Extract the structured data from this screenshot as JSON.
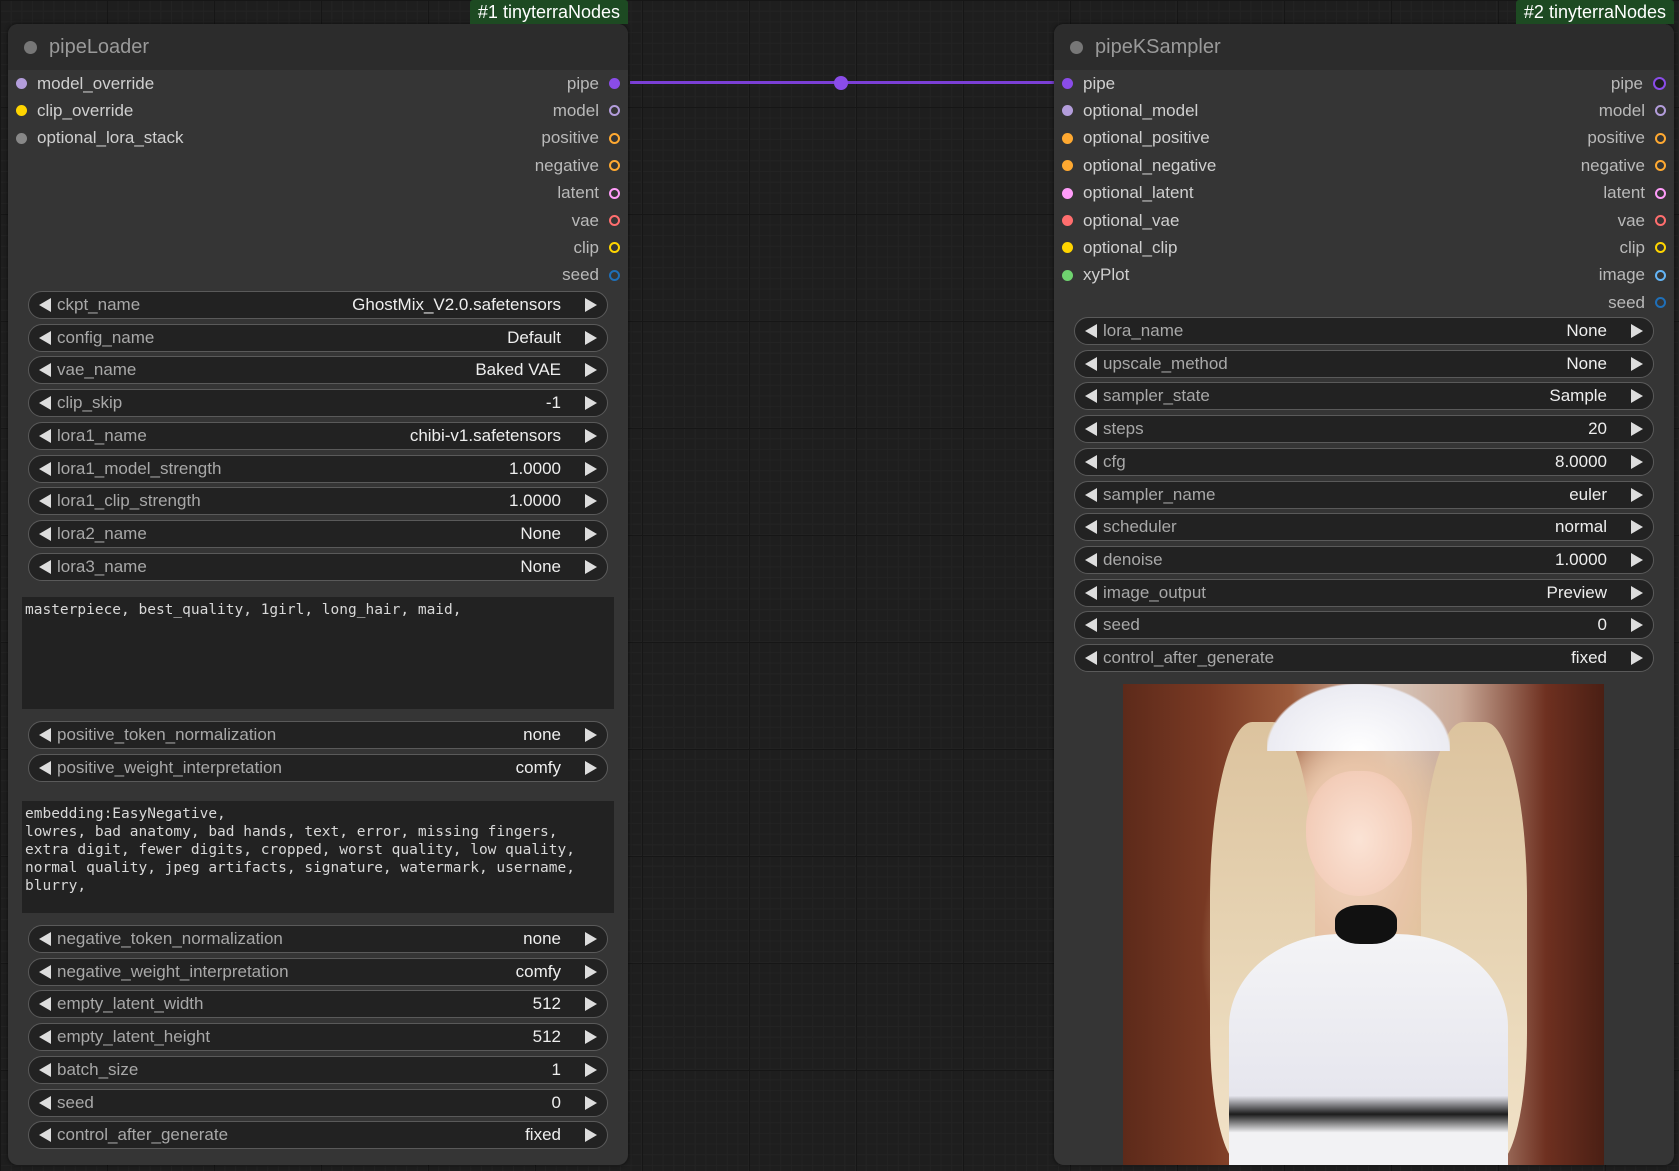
{
  "links": {
    "color": "#7b3fd6"
  },
  "nodes": [
    {
      "badge": "#1 tinyterraNodes",
      "title": "pipeLoader",
      "inputs": [
        {
          "label": "model_override",
          "color": "#b39ddb"
        },
        {
          "label": "clip_override",
          "color": "#ffd500"
        },
        {
          "label": "optional_lora_stack",
          "color": "#888888"
        }
      ],
      "outputs": [
        {
          "label": "pipe",
          "color": "#8a4ce8"
        },
        {
          "label": "model",
          "color": "#b39ddb"
        },
        {
          "label": "positive",
          "color": "#ffa931"
        },
        {
          "label": "negative",
          "color": "#ffa931"
        },
        {
          "label": "latent",
          "color": "#ff9cf9"
        },
        {
          "label": "vae",
          "color": "#ff6e6e"
        },
        {
          "label": "clip",
          "color": "#ffd500"
        },
        {
          "label": "seed",
          "color": "#1f6fb8"
        }
      ],
      "widgets_a": [
        {
          "label": "ckpt_name",
          "value": "GhostMix_V2.0.safetensors"
        },
        {
          "label": "config_name",
          "value": "Default"
        },
        {
          "label": "vae_name",
          "value": "Baked VAE"
        },
        {
          "label": "clip_skip",
          "value": "-1"
        },
        {
          "label": "lora1_name",
          "value": "chibi-v1.safetensors"
        },
        {
          "label": "lora1_model_strength",
          "value": "1.0000"
        },
        {
          "label": "lora1_clip_strength",
          "value": "1.0000"
        },
        {
          "label": "lora2_name",
          "value": "None"
        },
        {
          "label": "lora3_name",
          "value": "None"
        }
      ],
      "positive_text": "masterpiece, best_quality, 1girl, long_hair, maid,",
      "widgets_b": [
        {
          "label": "positive_token_normalization",
          "value": "none"
        },
        {
          "label": "positive_weight_interpretation",
          "value": "comfy"
        }
      ],
      "negative_text": "embedding:EasyNegative,\nlowres, bad anatomy, bad hands, text, error, missing fingers,\nextra digit, fewer digits, cropped, worst quality, low quality,\nnormal quality, jpeg artifacts, signature, watermark, username,\nblurry,",
      "widgets_c": [
        {
          "label": "negative_token_normalization",
          "value": "none"
        },
        {
          "label": "negative_weight_interpretation",
          "value": "comfy"
        },
        {
          "label": "empty_latent_width",
          "value": "512"
        },
        {
          "label": "empty_latent_height",
          "value": "512"
        },
        {
          "label": "batch_size",
          "value": "1"
        },
        {
          "label": "seed",
          "value": "0"
        },
        {
          "label": "control_after_generate",
          "value": "fixed"
        }
      ]
    },
    {
      "badge": "#2 tinyterraNodes",
      "title": "pipeKSampler",
      "inputs": [
        {
          "label": "pipe",
          "color": "#8a4ce8"
        },
        {
          "label": "optional_model",
          "color": "#b39ddb"
        },
        {
          "label": "optional_positive",
          "color": "#ffa931"
        },
        {
          "label": "optional_negative",
          "color": "#ffa931"
        },
        {
          "label": "optional_latent",
          "color": "#ff9cf9"
        },
        {
          "label": "optional_vae",
          "color": "#ff6e6e"
        },
        {
          "label": "optional_clip",
          "color": "#ffd500"
        },
        {
          "label": "xyPlot",
          "color": "#6fd36f"
        }
      ],
      "outputs": [
        {
          "label": "pipe",
          "color": "#8a4ce8"
        },
        {
          "label": "model",
          "color": "#b39ddb"
        },
        {
          "label": "positive",
          "color": "#ffa931"
        },
        {
          "label": "negative",
          "color": "#ffa931"
        },
        {
          "label": "latent",
          "color": "#ff9cf9"
        },
        {
          "label": "vae",
          "color": "#ff6e6e"
        },
        {
          "label": "clip",
          "color": "#ffd500"
        },
        {
          "label": "image",
          "color": "#64b5f6"
        },
        {
          "label": "seed",
          "color": "#1f6fb8"
        }
      ],
      "widgets": [
        {
          "label": "lora_name",
          "value": "None"
        },
        {
          "label": "upscale_method",
          "value": "None"
        },
        {
          "label": "sampler_state",
          "value": "Sample"
        },
        {
          "label": "steps",
          "value": "20"
        },
        {
          "label": "cfg",
          "value": "8.0000"
        },
        {
          "label": "sampler_name",
          "value": "euler"
        },
        {
          "label": "scheduler",
          "value": "normal"
        },
        {
          "label": "denoise",
          "value": "1.0000"
        },
        {
          "label": "image_output",
          "value": "Preview"
        },
        {
          "label": "seed",
          "value": "0"
        },
        {
          "label": "control_after_generate",
          "value": "fixed"
        }
      ]
    }
  ]
}
